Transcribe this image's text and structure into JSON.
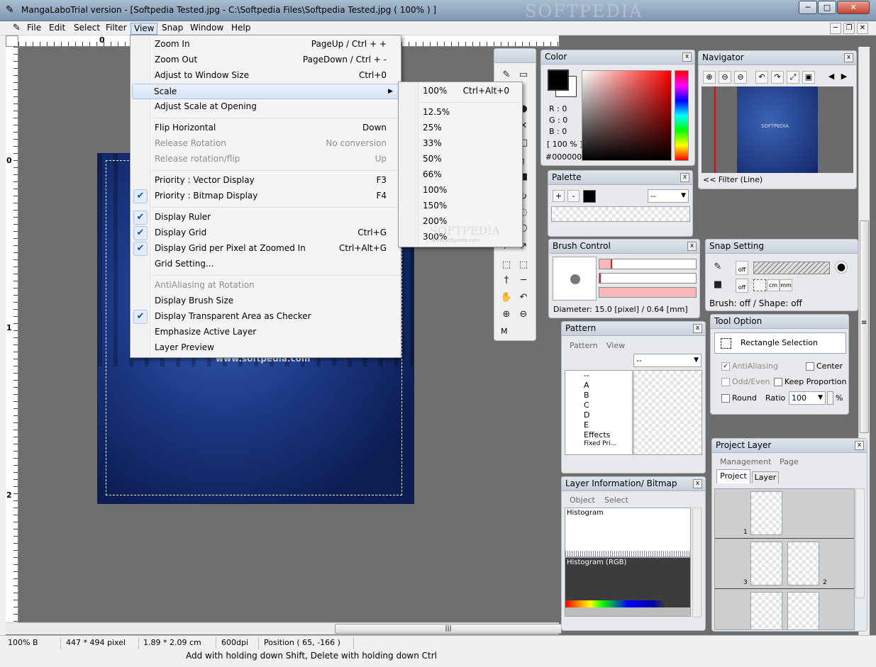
{
  "window": {
    "title": "MangaLaboTrial version - [Softpedia Tested.jpg - C:\\Softpedia Files\\Softpedia Tested.jpg ( 100% ) ]",
    "watermark": "SOFTPEDIA",
    "btn_min": "─",
    "btn_max": "□",
    "btn_close": "✕"
  },
  "menubar": {
    "items": [
      "File",
      "Edit",
      "Select",
      "Filter",
      "View",
      "Snap",
      "Window",
      "Help"
    ],
    "active": "View",
    "mdi_min": "─",
    "mdi_restore": "❐",
    "mdi_close": "✕"
  },
  "rulers": {
    "h0": "0",
    "v0": "0",
    "v1": "1",
    "v2": "2"
  },
  "document": {
    "url_text": "www.softpedia.com"
  },
  "view_menu": {
    "items": [
      {
        "label": "Zoom In",
        "shortcut": "PageUp / Ctrl + +"
      },
      {
        "label": "Zoom Out",
        "shortcut": "PageDown / Ctrl + -"
      },
      {
        "label": "Adjust to Window Size",
        "shortcut": "Ctrl+0"
      },
      {
        "label": "Scale",
        "shortcut": "▶"
      },
      {
        "label": "Adjust Scale at Opening",
        "shortcut": ""
      },
      {
        "label": "Flip Horizontal",
        "shortcut": "Down"
      },
      {
        "label": "Release Rotation",
        "shortcut": "No conversion"
      },
      {
        "label": "Release rotation/flip",
        "shortcut": "Up"
      },
      {
        "label": "Priority : Vector Display",
        "shortcut": "F3"
      },
      {
        "label": "Priority : Bitmap Display",
        "shortcut": "F4"
      },
      {
        "label": "Display Ruler",
        "shortcut": ""
      },
      {
        "label": "Display Grid",
        "shortcut": "Ctrl+G"
      },
      {
        "label": "Display Grid per Pixel at Zoomed In",
        "shortcut": "Ctrl+Alt+G"
      },
      {
        "label": "Grid Setting...",
        "shortcut": ""
      },
      {
        "label": "AntiAliasing at Rotation",
        "shortcut": ""
      },
      {
        "label": "Display Brush Size",
        "shortcut": ""
      },
      {
        "label": "Display Transparent Area as Checker",
        "shortcut": ""
      },
      {
        "label": "Emphasize Active Layer",
        "shortcut": ""
      },
      {
        "label": "Layer Preview",
        "shortcut": ""
      }
    ],
    "check": "✔"
  },
  "scale_menu": {
    "items": [
      {
        "label": "100%",
        "shortcut": "Ctrl+Alt+0"
      },
      {
        "label": "12.5%",
        "shortcut": ""
      },
      {
        "label": "25%",
        "shortcut": ""
      },
      {
        "label": "33%",
        "shortcut": ""
      },
      {
        "label": "50%",
        "shortcut": ""
      },
      {
        "label": "66%",
        "shortcut": ""
      },
      {
        "label": "100%",
        "shortcut": ""
      },
      {
        "label": "150%",
        "shortcut": ""
      },
      {
        "label": "200%",
        "shortcut": ""
      },
      {
        "label": "300%",
        "shortcut": ""
      }
    ],
    "watermark": "SOFTPEDIA",
    "watermark_url": "www.softpedia.com"
  },
  "toolbox": {
    "mode_label": "M",
    "icons": [
      "✎",
      "▭",
      "●",
      "✕",
      "□",
      "┐",
      "■",
      "↻",
      "◌",
      "○",
      "⁄",
      "↗",
      "⬚",
      "⬚",
      "†",
      "─",
      "✋",
      "↶",
      "⊕",
      "⊖"
    ]
  },
  "color_panel": {
    "title": "Color",
    "r": "R : 0",
    "g": "G : 0",
    "b": "B : 0",
    "pct": "[ 100 % ]",
    "hex": "#000000",
    "fg": "#000000",
    "bg": "#ffffff",
    "close": "x"
  },
  "navigator": {
    "title": "Navigator",
    "filter": "<< Filter (Line)",
    "thumb_text": "SOFTPEDIA",
    "icons": [
      "⊕",
      "⊖",
      "⊖",
      "↶",
      "↷",
      "⤢",
      "▣",
      "◀",
      "▶"
    ],
    "close": "x"
  },
  "palette": {
    "title": "Palette",
    "add": "+",
    "remove": "-",
    "select_value": "--",
    "close": "x"
  },
  "brush_control": {
    "title": "Brush Control",
    "diameter": "Diameter: 15.0 [pixel] / 0.64 [mm]",
    "close": "x"
  },
  "snap_setting": {
    "title": "Snap Setting",
    "off1": "off",
    "off2": "off",
    "cm": "cm",
    "mm": "mm",
    "status": "Brush: off / Shape: off"
  },
  "pattern": {
    "title": "Pattern",
    "tabs": [
      "Pattern",
      "View"
    ],
    "select_value": "--",
    "tree": [
      "--",
      "A",
      "B",
      "C",
      "D",
      "E",
      "Effects",
      "Fixed Pri..."
    ],
    "close": "x"
  },
  "tool_option": {
    "title": "Tool Option",
    "tool_name": "Rectangle Selection",
    "antialiasing": "AntiAliasing",
    "center": "Center",
    "odd_even": "Odd/Even",
    "keep_proportion": "Keep Proportion",
    "round": "Round",
    "ratio_label": "Ratio",
    "ratio_value": "100",
    "percent": "%"
  },
  "layer_info": {
    "title": "Layer Information/ Bitmap",
    "tabs": [
      "Object",
      "Select"
    ],
    "histogram": "Histogram",
    "histogram_rgb": "Histogram (RGB)",
    "close": "x"
  },
  "project_layer": {
    "title": "Project Layer",
    "tabs_top": [
      "Management",
      "Page"
    ],
    "tabs": [
      "Project",
      "Layer"
    ],
    "page_nums": [
      "1",
      "3",
      "2"
    ],
    "close": "x"
  },
  "statusbar": {
    "zoom": "100% B",
    "pixels": "447 * 494 pixel",
    "size": "1.89 * 2.09 cm",
    "dpi": "600dpi",
    "position": "Position ( 65, -166 )",
    "hint": "Add with holding down Shift, Delete with holding down Ctrl"
  },
  "scroll": {
    "grip": "|||",
    "grip_v": "≡"
  }
}
